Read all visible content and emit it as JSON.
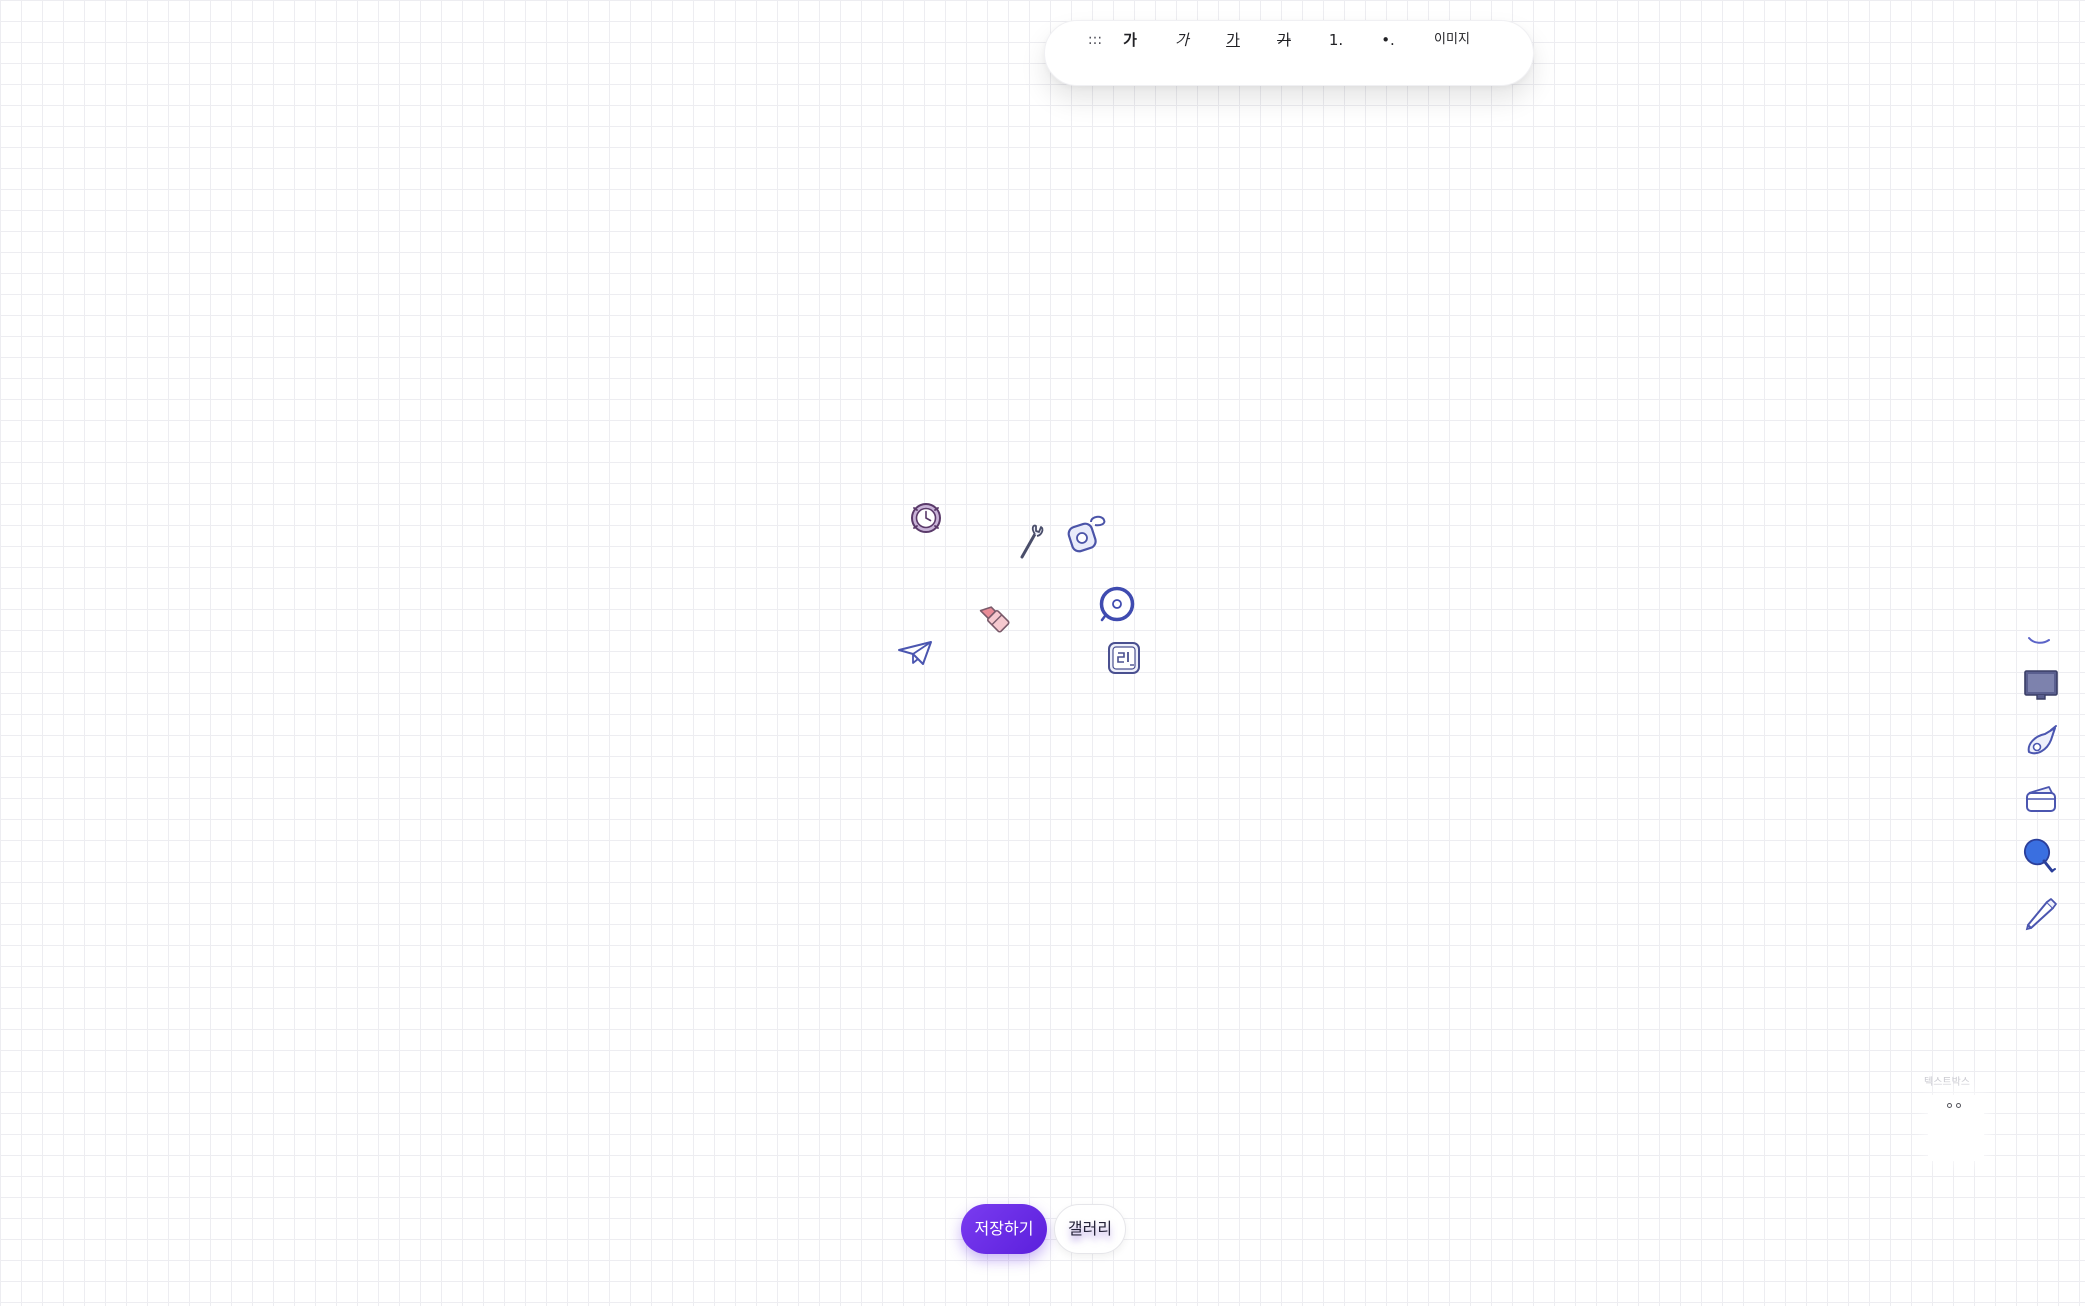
{
  "toolbar": {
    "grip_label": ":::",
    "bold_label": "가",
    "italic_label": "가",
    "underline_label": "가",
    "strike_label": "가",
    "ordered_list_label": "1.",
    "bullet_list_label": "•.",
    "image_label": "이미지"
  },
  "canvas": {
    "stickers": [
      "watch-icon",
      "wrench-icon",
      "perfume-icon",
      "lipstick-icon",
      "disc-icon",
      "paper-plane-icon",
      "calendar-icon"
    ]
  },
  "sticker_rail": {
    "items": [
      "monitor-icon",
      "brush-icon",
      "wallet-icon",
      "ice-pop-icon",
      "pen-icon"
    ]
  },
  "textbox_widget": {
    "label": "텍스트박스"
  },
  "actions": {
    "save_label": "저장하기",
    "gallery_label": "갤러리"
  },
  "colors": {
    "accent": "#6a2ae6",
    "icon_stroke": "#5b64c8",
    "grid_line": "#ededf1"
  }
}
